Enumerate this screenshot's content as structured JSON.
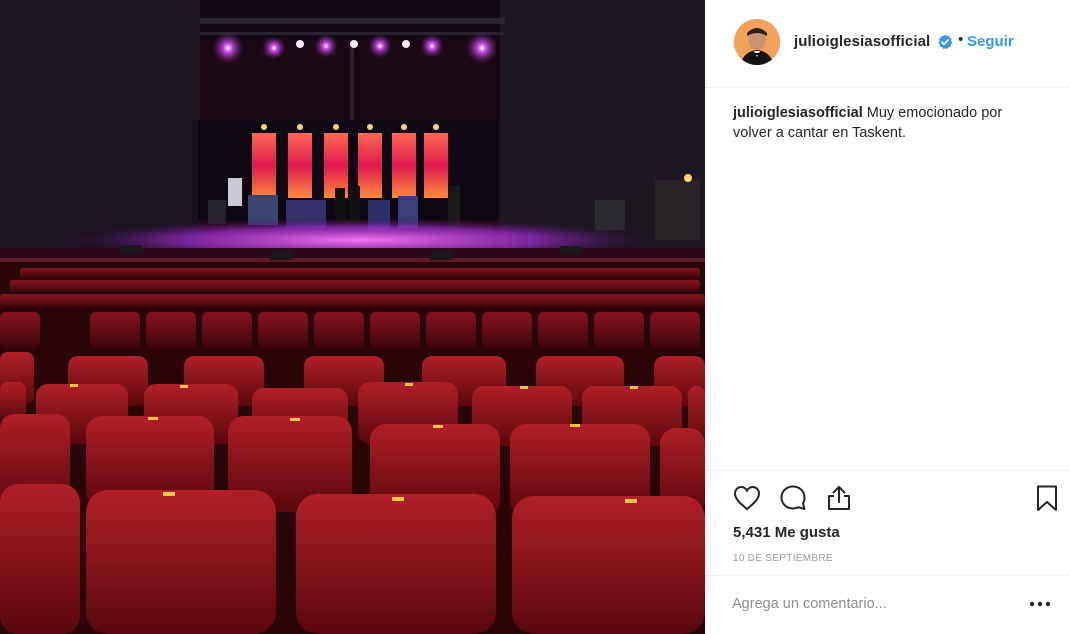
{
  "post": {
    "username": "julioiglesiasofficial",
    "separator": "•",
    "follow_label": "Seguir",
    "caption_user": "julioiglesiasofficial",
    "caption_text": " Muy emocionado por volver a cantar en Taskent.",
    "likes": "5,431 Me gusta",
    "date": "10 DE SEPTIEMBRE",
    "comment_placeholder": "Agrega un comentario..."
  },
  "icons": {
    "verified": "verified-badge-icon",
    "like": "heart-icon",
    "comment": "comment-bubble-icon",
    "share": "share-upload-icon",
    "save": "bookmark-icon",
    "more": "more-options-icon"
  },
  "colors": {
    "link_blue": "#3897f0",
    "text": "#262626",
    "muted": "#999999",
    "divider": "#efefef",
    "seat_red": "#8a0f16",
    "stage_purple": "#b23be0"
  }
}
